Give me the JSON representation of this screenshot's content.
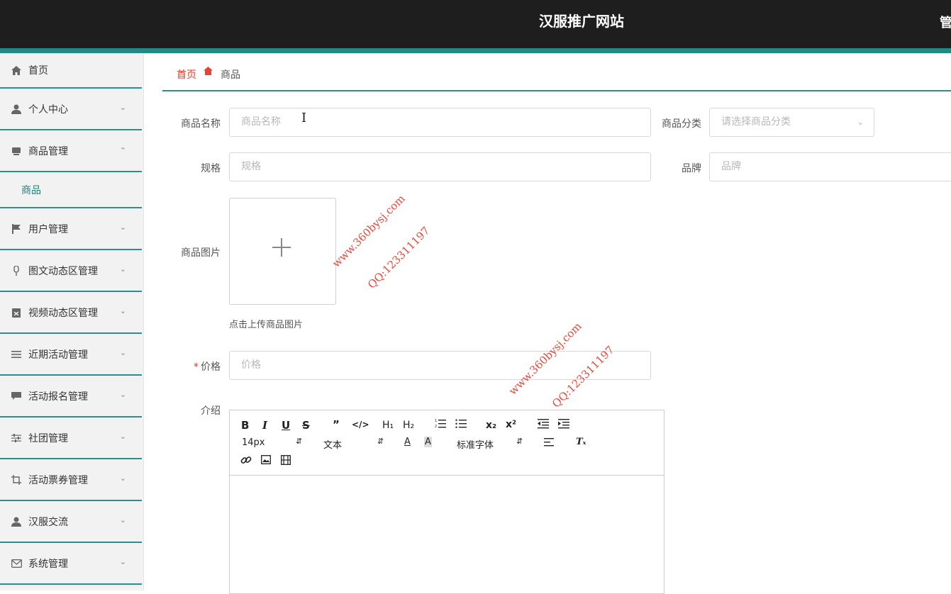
{
  "header": {
    "title": "汉服推广网站",
    "admin_label": "管"
  },
  "sidebar": {
    "items": [
      {
        "label": "首页",
        "icon": "home-icon"
      },
      {
        "label": "个人中心",
        "icon": "user-icon"
      },
      {
        "label": "商品管理",
        "icon": "box-icon",
        "expanded": true,
        "sub": [
          "商品"
        ]
      },
      {
        "label": "用户管理",
        "icon": "flag-icon"
      },
      {
        "label": "图文动态区管理",
        "icon": "mic-icon"
      },
      {
        "label": "视频动态区管理",
        "icon": "clipboard-icon"
      },
      {
        "label": "近期活动管理",
        "icon": "list-icon"
      },
      {
        "label": "活动报名管理",
        "icon": "chat-icon"
      },
      {
        "label": "社团管理",
        "icon": "sliders-icon"
      },
      {
        "label": "活动票券管理",
        "icon": "crop-icon"
      },
      {
        "label": "汉服交流",
        "icon": "user-icon"
      },
      {
        "label": "系统管理",
        "icon": "mail-icon"
      }
    ]
  },
  "breadcrumb": {
    "home": "首页",
    "current": "商品"
  },
  "form": {
    "name": {
      "label": "商品名称",
      "placeholder": "商品名称"
    },
    "category": {
      "label": "商品分类",
      "placeholder": "请选择商品分类"
    },
    "spec": {
      "label": "规格",
      "placeholder": "规格"
    },
    "brand": {
      "label": "品牌",
      "placeholder": "品牌"
    },
    "image": {
      "label": "商品图片",
      "tip": "点击上传商品图片"
    },
    "price": {
      "label": "价格",
      "required_mark": "*",
      "placeholder": "价格"
    },
    "intro": {
      "label": "介绍"
    }
  },
  "editor": {
    "font_size": "14px",
    "text_type": "文本",
    "font_family": "标准字体"
  },
  "watermarks": [
    {
      "site": "www.360bysj.com",
      "qq": "QQ:123311197"
    },
    {
      "site": "www.360bysj.com",
      "qq": "QQ:123311197"
    }
  ]
}
